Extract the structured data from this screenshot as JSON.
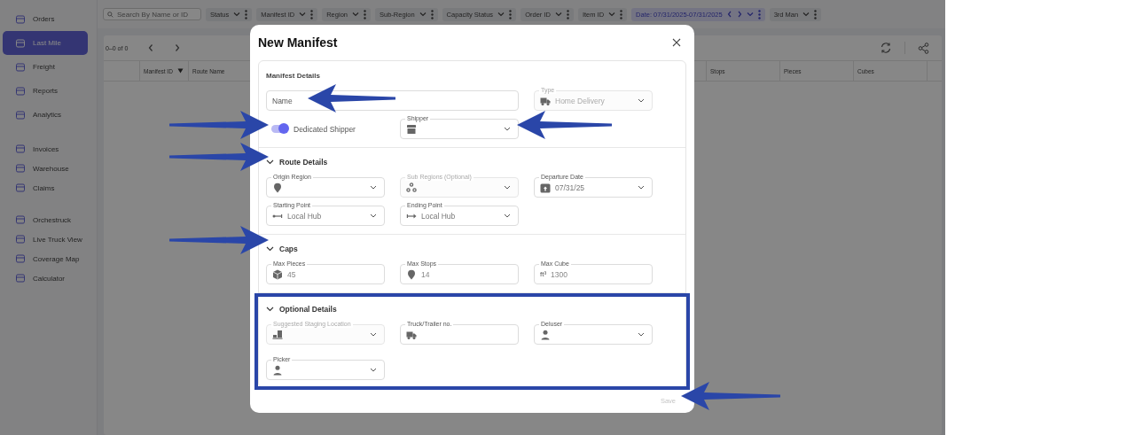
{
  "sidebar": {
    "groups": [
      {
        "items": [
          {
            "label": "Orders",
            "selected": false
          },
          {
            "label": "Last Mile",
            "selected": true
          },
          {
            "label": "Freight",
            "selected": false
          },
          {
            "label": "Reports",
            "selected": false
          },
          {
            "label": "Analytics",
            "selected": false
          }
        ]
      },
      {
        "items": [
          {
            "label": "Invoices",
            "selected": false
          },
          {
            "label": "Warehouse",
            "selected": false
          },
          {
            "label": "Claims",
            "selected": false
          }
        ]
      },
      {
        "items": [
          {
            "label": "Orchestruck",
            "selected": false
          },
          {
            "label": "Live Truck View",
            "selected": false
          },
          {
            "label": "Coverage Map",
            "selected": false
          },
          {
            "label": "Calculator",
            "selected": false
          }
        ]
      }
    ]
  },
  "toolbar": {
    "search": {
      "placeholder": "Search By Name or ID"
    },
    "filters": [
      {
        "label": "Status",
        "kind": "dropdown"
      },
      {
        "label": "Manifest ID",
        "kind": "dropdown"
      },
      {
        "label": "Region",
        "kind": "dropdown"
      },
      {
        "label": "Sub-Region",
        "kind": "dropdown"
      },
      {
        "label": "Capacity Status",
        "kind": "dropdown"
      },
      {
        "label": "Order ID",
        "kind": "dropdown"
      },
      {
        "label": "Item ID",
        "kind": "dropdown"
      },
      {
        "label": "Date: 07/31/2025-07/31/2025",
        "kind": "date"
      },
      {
        "label": "3rd Man",
        "kind": "dropdown"
      }
    ]
  },
  "table": {
    "pager": "0–0 of 0",
    "columns": [
      "Manifest ID",
      "Route Name",
      "Stops",
      "Pieces",
      "Cubes"
    ]
  },
  "modal": {
    "title": "New Manifest",
    "sections": [
      {
        "title": "Manifest Details",
        "kind": "plain",
        "items": [
          {
            "kind": "text",
            "placeholder": "Name"
          },
          {
            "kind": "select",
            "label": "Type",
            "value": "Home Delivery",
            "disabled": true
          },
          {
            "kind": "toggle",
            "label": "Dedicated Shipper",
            "on": true
          },
          {
            "kind": "select",
            "label": "Shipper"
          }
        ]
      },
      {
        "title": "Route Details",
        "kind": "collapsible",
        "items": [
          {
            "kind": "select",
            "label": "Origin Region"
          },
          {
            "kind": "select",
            "label": "Sub Regions (Optional)",
            "disabled": true
          },
          {
            "kind": "select",
            "label": "Departure Date",
            "value": "07/31/25"
          },
          {
            "kind": "select",
            "label": "Starting Point",
            "value": "Local Hub"
          },
          {
            "kind": "select",
            "label": "Ending Point",
            "value": "Local Hub"
          }
        ]
      },
      {
        "title": "Caps",
        "kind": "collapsible",
        "items": [
          {
            "kind": "input",
            "label": "Max Pieces",
            "value": "45"
          },
          {
            "kind": "input",
            "label": "Max Stops",
            "value": "14"
          },
          {
            "kind": "input",
            "label": "Max Cube",
            "prefix": "ft³",
            "value": "1300"
          }
        ]
      },
      {
        "title": "Optional Details",
        "kind": "collapsible",
        "highlighted": true,
        "items": [
          {
            "kind": "select",
            "label": "Suggested Staging Location",
            "disabled": true
          },
          {
            "kind": "input",
            "label": "Truck/Trailer no."
          },
          {
            "kind": "select",
            "label": "Deluser"
          },
          {
            "kind": "select",
            "label": "Picker"
          }
        ]
      }
    ],
    "save": {
      "label": "Save",
      "disabled": true
    }
  }
}
